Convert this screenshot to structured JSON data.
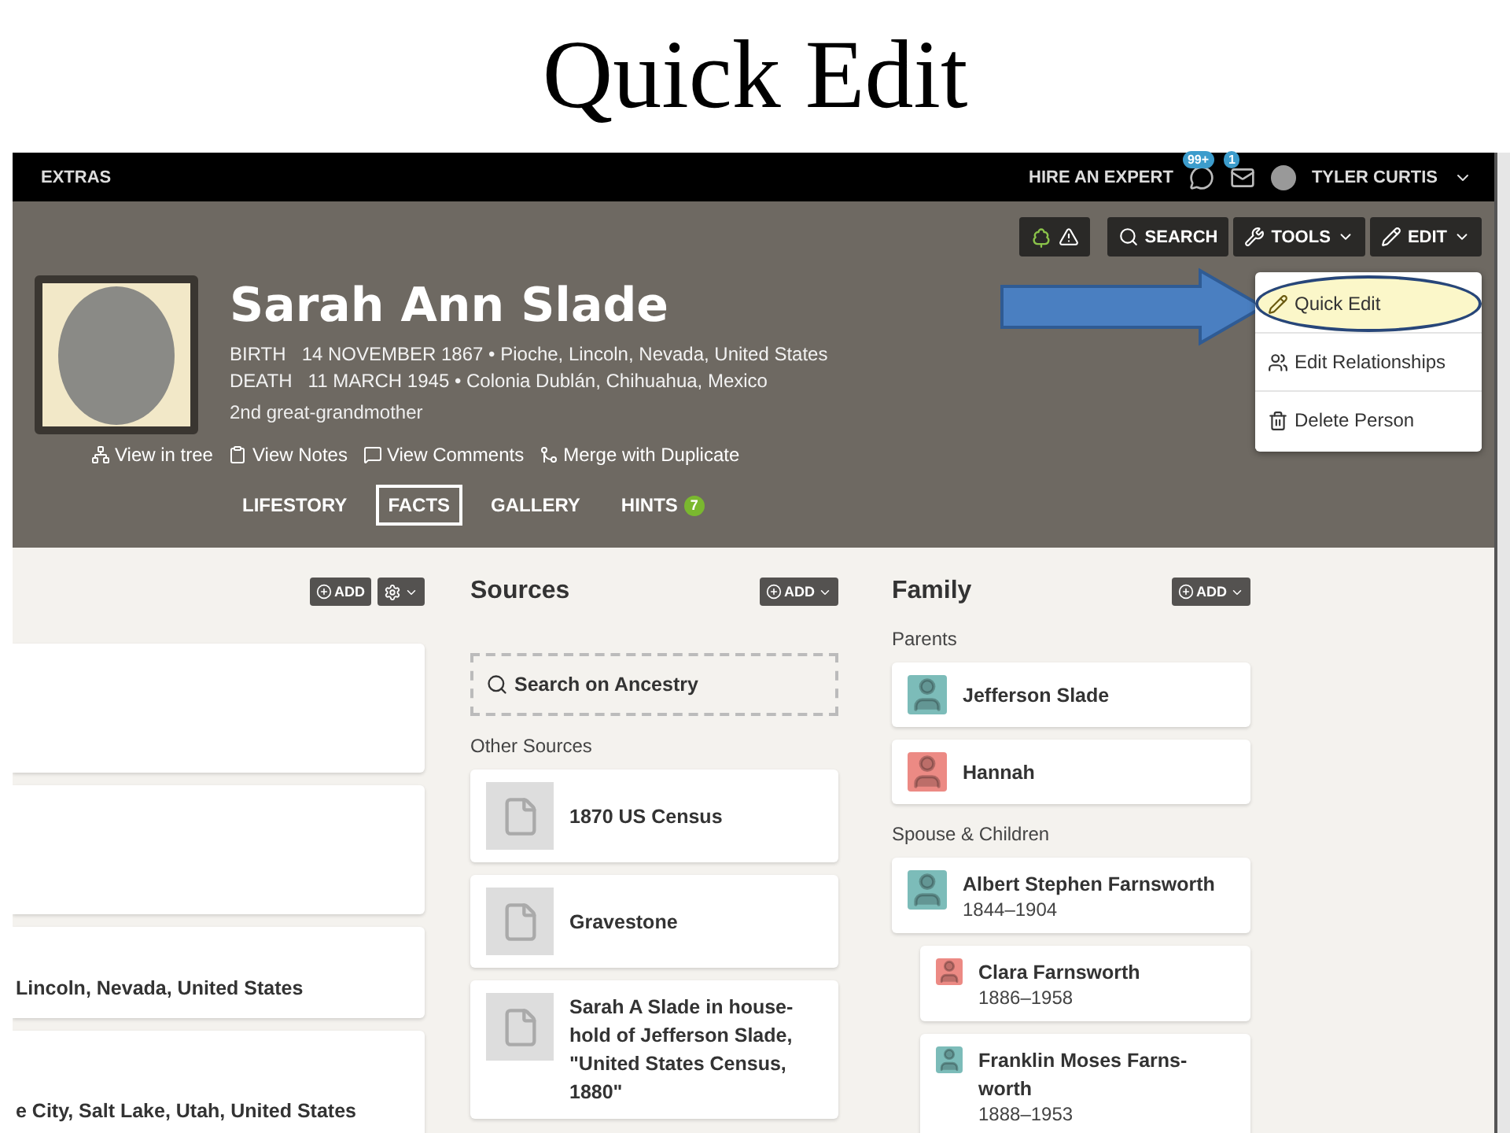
{
  "slide_title": "Quick Edit",
  "top_bar": {
    "extras": "EXTRAS",
    "hire": "HIRE AN EXPERT",
    "hints_badge": "99+",
    "messages_badge": "1",
    "user": "TYLER CURTIS"
  },
  "toolbar": [
    {
      "kind": "search",
      "label": "SEARCH"
    },
    {
      "kind": "tools",
      "label": "TOOLS"
    },
    {
      "kind": "edit",
      "label": "EDIT"
    }
  ],
  "edit_menu": [
    {
      "kind": "quick",
      "label": "Quick Edit",
      "selected": true
    },
    {
      "kind": "relationships",
      "label": "Edit Relationships",
      "selected": false
    },
    {
      "kind": "delete",
      "label": "Delete Person",
      "selected": false
    }
  ],
  "person": {
    "name": "Sarah Ann Slade",
    "relationship": "2nd great-grandmother",
    "separator": "•",
    "events": [
      {
        "label": "BIRTH",
        "date": "14 NOVEMBER 1867",
        "place": "Pioche, Lincoln, Nevada, United States"
      },
      {
        "label": "DEATH",
        "date": "11 MARCH 1945",
        "place": "Colonia Dublán, Chihuahua, Mexico"
      }
    ],
    "links": [
      {
        "kind": "tree",
        "label": "View in tree"
      },
      {
        "kind": "notes",
        "label": "View Notes"
      },
      {
        "kind": "comments",
        "label": "View Comments"
      },
      {
        "kind": "merge",
        "label": "Merge with Duplicate"
      }
    ]
  },
  "tabs": [
    {
      "label": "LIFESTORY",
      "selected": false
    },
    {
      "label": "FACTS",
      "selected": true
    },
    {
      "label": "GALLERY",
      "selected": false
    },
    {
      "label": "HINTS",
      "selected": false,
      "count": "7"
    }
  ],
  "facts": {
    "add": "ADD",
    "places": [
      "Lincoln, Nevada, United States",
      "e City, Salt Lake, Utah, United States"
    ]
  },
  "sources": {
    "title": "Sources",
    "add": "ADD",
    "search": "Search on Ancestry",
    "subtitle": "Other Sources",
    "items": [
      "1870 US Census",
      "Gravestone",
      "Sarah A Slade in house-hold of Jefferson Slade, \"United States Census, 1880\""
    ]
  },
  "family": {
    "title": "Family",
    "add": "ADD",
    "parents_label": "Parents",
    "spouse_label": "Spouse & Children",
    "parents": [
      {
        "name": "Jefferson Slade",
        "color": "#7cbcb9"
      },
      {
        "name": "Hannah",
        "color": "#ec8a84"
      }
    ],
    "spouses": [
      {
        "name": "Albert Stephen Farnsworth",
        "years": "1844–1904",
        "color": "#7cbcb9"
      }
    ],
    "children": [
      {
        "name": "Clara Farnsworth",
        "years": "1886–1958",
        "color": "#ec8a84"
      },
      {
        "name": "Franklin Moses Farns-worth",
        "years": "1888–1953",
        "color": "#7cbcb9"
      }
    ]
  }
}
